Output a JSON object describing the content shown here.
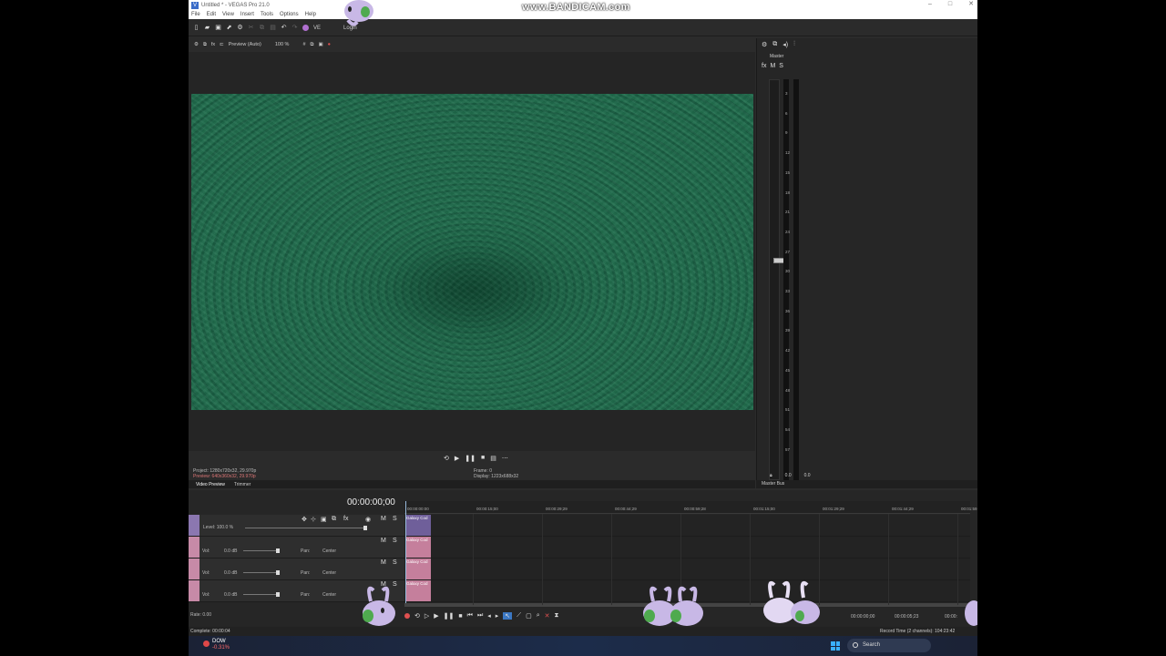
{
  "window": {
    "title": "Untitled * - VEGAS Pro 21.0",
    "logo": "V"
  },
  "menu": [
    "File",
    "Edit",
    "View",
    "Insert",
    "Tools",
    "Options",
    "Help"
  ],
  "toolbar": {
    "vegas_label": "VE",
    "login": "Login"
  },
  "preview": {
    "mode": "Preview (Auto)",
    "zoom": "100 %",
    "project": "Project:  1280x720x32, 29.970p",
    "preview_info": "Preview: 640x360x32, 29.970p",
    "frame": "Frame:    0",
    "display": "Display:   1223x688x32",
    "tabs": [
      "Video Preview",
      "Trimmer"
    ]
  },
  "master": {
    "label": "Master",
    "m": "M",
    "s": "S",
    "scale": [
      "3",
      "6",
      "9",
      "12",
      "15",
      "18",
      "21",
      "24",
      "27",
      "30",
      "33",
      "36",
      "39",
      "42",
      "45",
      "48",
      "51",
      "54",
      "57"
    ],
    "left_value": "0.0",
    "right_value": "0.0",
    "tab": "Master Bus"
  },
  "timeline": {
    "timecode": "00:00:00;00",
    "ruler": [
      "00:00:00:00",
      "00:00:15;00",
      "00:00:29;29",
      "00:00:44;29",
      "00:00:59;28",
      "00:01:15;00",
      "00:01:29;29",
      "00:01:44;29",
      "00:01:59;"
    ],
    "video_track": {
      "level": "Level: 100.0 %",
      "m": "M",
      "s": "S",
      "clip": "Galaxy Cod"
    },
    "audio_tracks": [
      {
        "vol_label": "Vol:",
        "vol": "0.0 dB",
        "pan_label": "Pan:",
        "pan": "Center",
        "m": "M",
        "s": "S",
        "clip": "Galaxy Cod"
      },
      {
        "vol_label": "Vol:",
        "vol": "0.0 dB",
        "pan_label": "Pan:",
        "pan": "Center",
        "m": "M",
        "s": "S",
        "clip": "Galaxy Cod"
      },
      {
        "vol_label": "Vol:",
        "vol": "0.0 dB",
        "pan_label": "Pan:",
        "pan": "Center",
        "m": "M",
        "s": "S",
        "clip": "Galaxy Cod"
      }
    ],
    "rate": "Rate: 0.00",
    "tc1": "00:00:00;00",
    "tc2": "00:00:05;23",
    "tc3": "00:00:"
  },
  "status": {
    "complete": "Complete: 00:00:04",
    "record": "Record Time (2 channels): 104:23:42"
  },
  "taskbar": {
    "stock": "DOW",
    "stock_change": "-0.31%",
    "search": "Search"
  },
  "watermark": "www.BANDICAM.com"
}
